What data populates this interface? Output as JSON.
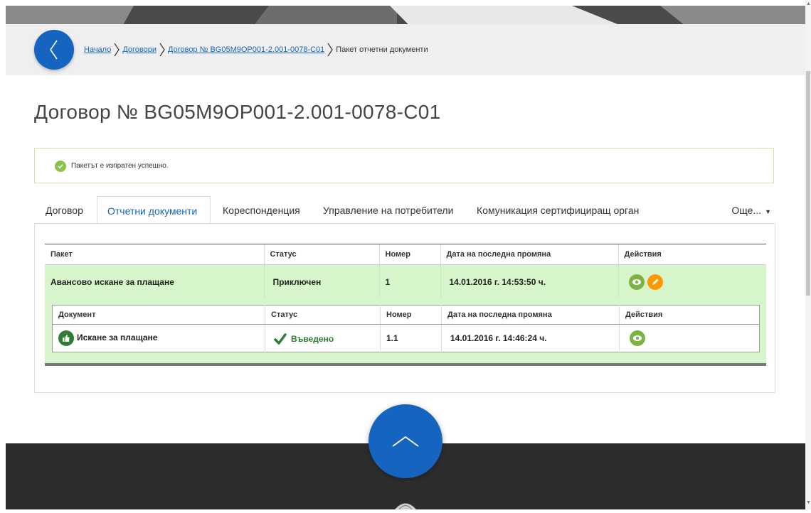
{
  "breadcrumb": {
    "items": [
      "Начало",
      "Договори",
      "Договор № BG05M9OP001-2.001-0078-C01"
    ],
    "current": "Пакет отчетни документи"
  },
  "page_title": "Договор № BG05M9OP001-2.001-0078-C01",
  "alert": {
    "message": "Пакетът е изпратен успешно.",
    "color": "#8bc34a"
  },
  "tabs": {
    "items": [
      "Договор",
      "Отчетни документи",
      "Кореспонденция",
      "Управление на потребители",
      "Комуникация сертифициращ орган"
    ],
    "active": "Отчетни документи",
    "more": "Още..."
  },
  "packages": {
    "headers": [
      "Пакет",
      "Статус",
      "Номер",
      "Дата на последна промяна",
      "Действия"
    ],
    "row": {
      "name": "Авансово искане за плащане",
      "status": "Приключен",
      "number": "1",
      "date": "14.01.2016 г. 14:53:50 ч.",
      "actions": [
        "view-icon",
        "edit-icon"
      ]
    }
  },
  "documents": {
    "headers": [
      "Документ",
      "Статус",
      "Номер",
      "Дата на последна промяна",
      "Действия"
    ],
    "row": {
      "name": "Искане за плащане",
      "status": "Въведено",
      "number": "1.1",
      "date": "14.01.2016 г. 14:46:24 ч.",
      "actions": [
        "view-icon"
      ]
    }
  },
  "colors": {
    "accent": "#1565c0",
    "row_highlight": "#d7f5cb",
    "view": "#7cb342",
    "edit": "#ff9800",
    "footer": "#2d2d2d"
  }
}
